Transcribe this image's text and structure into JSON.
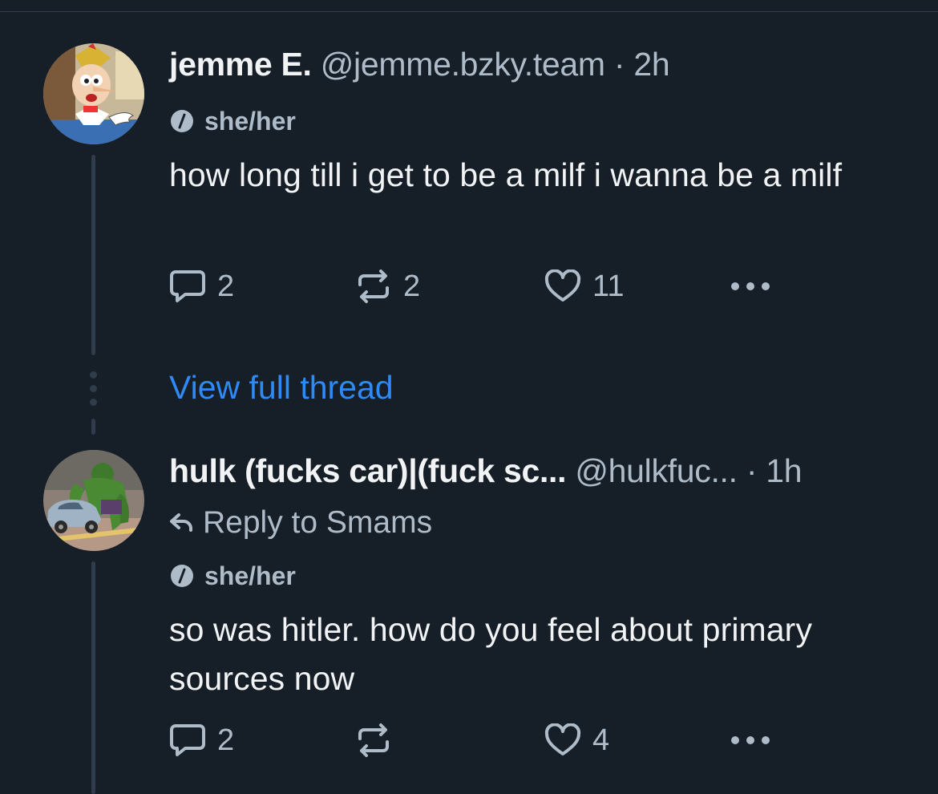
{
  "posts": [
    {
      "display_name": "jemme E.",
      "handle": "@jemme.bzky.team",
      "separator": "·",
      "time": "2h",
      "pronouns": "she/her",
      "text": "how long till i get to be a milf i wanna be a milf",
      "reply_count": "2",
      "repost_count": "2",
      "like_count": "11",
      "avatar_icon": "pinocchio-avatar"
    },
    {
      "display_name": "hulk (fucks car)|(fuck sc...",
      "handle": "@hulkfuc...",
      "separator": "·",
      "time": "1h",
      "reply_to": "Reply to Smams",
      "pronouns": "she/her",
      "text": "so was hitler. how do you feel about primary sources now",
      "reply_count": "2",
      "repost_count": "",
      "like_count": "4",
      "avatar_icon": "hulk-car-avatar"
    }
  ],
  "view_full_thread": "View full thread",
  "colors": {
    "background": "#161e27",
    "text": "#f1f3f5",
    "muted": "#aebbc9",
    "link": "#2f8af5",
    "thread_line": "#2e3c4b"
  }
}
